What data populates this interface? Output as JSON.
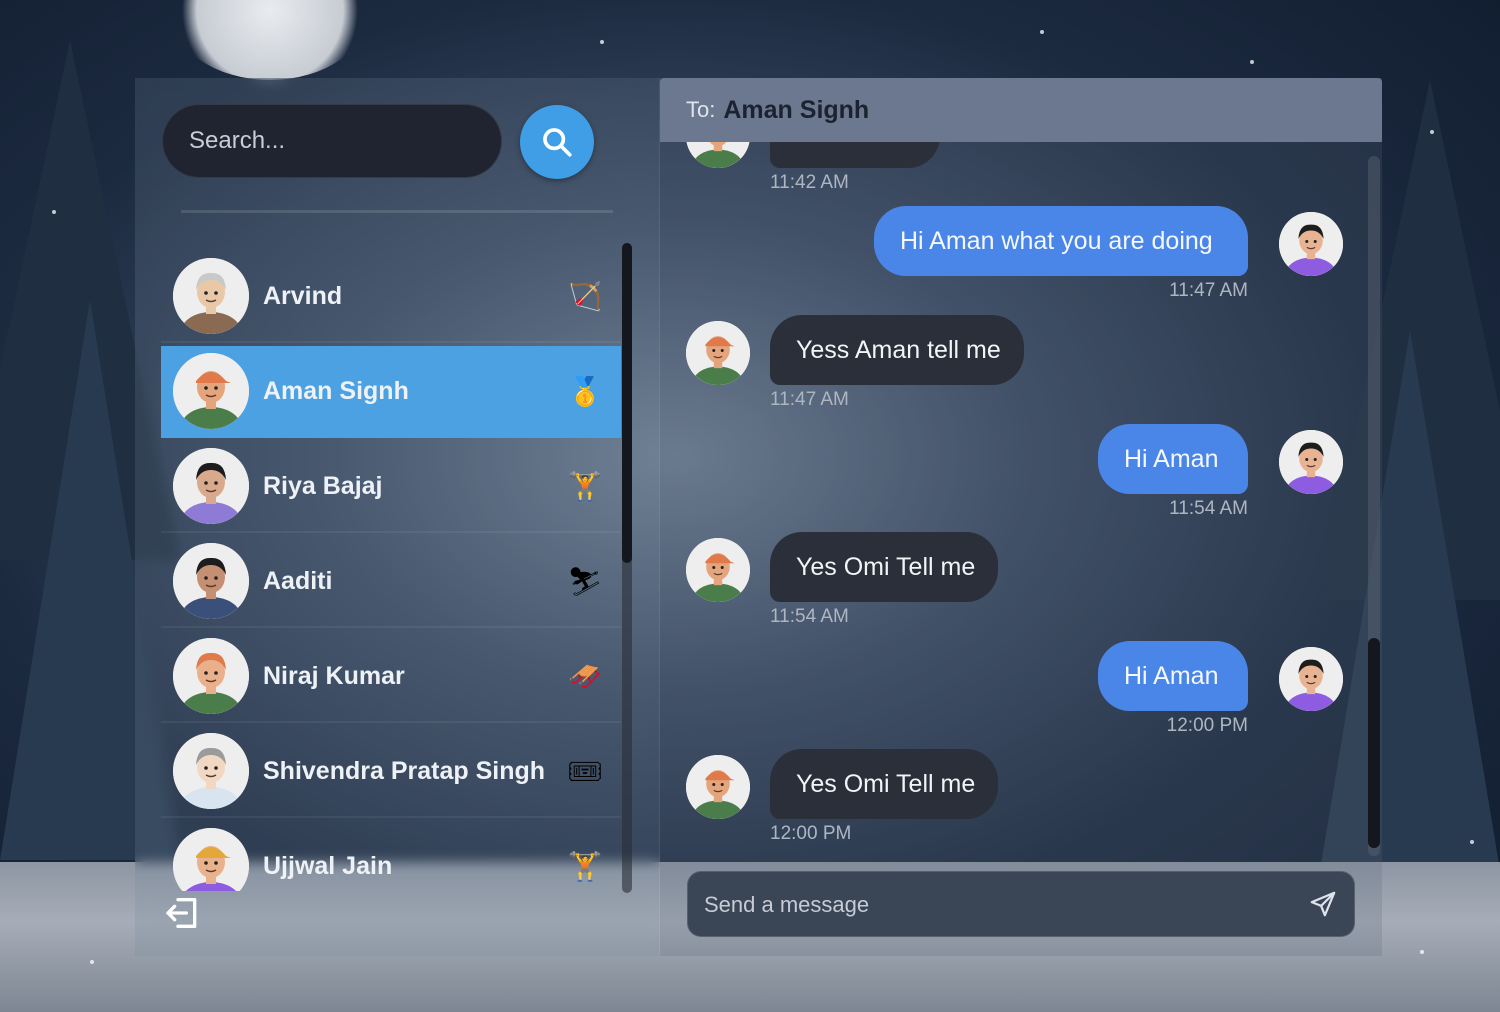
{
  "search": {
    "placeholder": "Search..."
  },
  "contacts": [
    {
      "name": "Arvind",
      "badge": "🏹",
      "active": false
    },
    {
      "name": "Aman Signh",
      "badge": "🥇",
      "active": true
    },
    {
      "name": "Riya Bajaj",
      "badge": "🏋",
      "active": false
    },
    {
      "name": "Aaditi",
      "badge": "⛷",
      "active": false
    },
    {
      "name": "Niraj Kumar",
      "badge": "🛷",
      "active": false
    },
    {
      "name": "Shivendra Pratap Singh",
      "badge": "🎟",
      "active": false
    },
    {
      "name": "Ujjwal Jain",
      "badge": "🏋",
      "active": false
    }
  ],
  "chat": {
    "to_label": "To:",
    "to_name": "Aman Signh",
    "messages": [
      {
        "direction": "in",
        "text": "",
        "time": "11:42 AM"
      },
      {
        "direction": "out",
        "text": "Hi Aman what you are doing",
        "time": "11:47 AM"
      },
      {
        "direction": "in",
        "text": "Yess Aman tell me",
        "time": "11:47 AM"
      },
      {
        "direction": "out",
        "text": "Hi Aman",
        "time": "11:54 AM"
      },
      {
        "direction": "in",
        "text": "Yes Omi Tell me",
        "time": "11:54 AM"
      },
      {
        "direction": "out",
        "text": "Hi Aman",
        "time": "12:00 PM"
      },
      {
        "direction": "in",
        "text": "Yes Omi Tell me",
        "time": "12:00 PM"
      }
    ],
    "composer_placeholder": "Send a message"
  },
  "colors": {
    "accent": "#4ca1e3",
    "outgoing_bubble": "#4a86e8",
    "incoming_bubble": "#2a2f3a",
    "header": "#6b7890"
  },
  "icons": [
    "search-icon",
    "logout-icon",
    "send-icon"
  ]
}
